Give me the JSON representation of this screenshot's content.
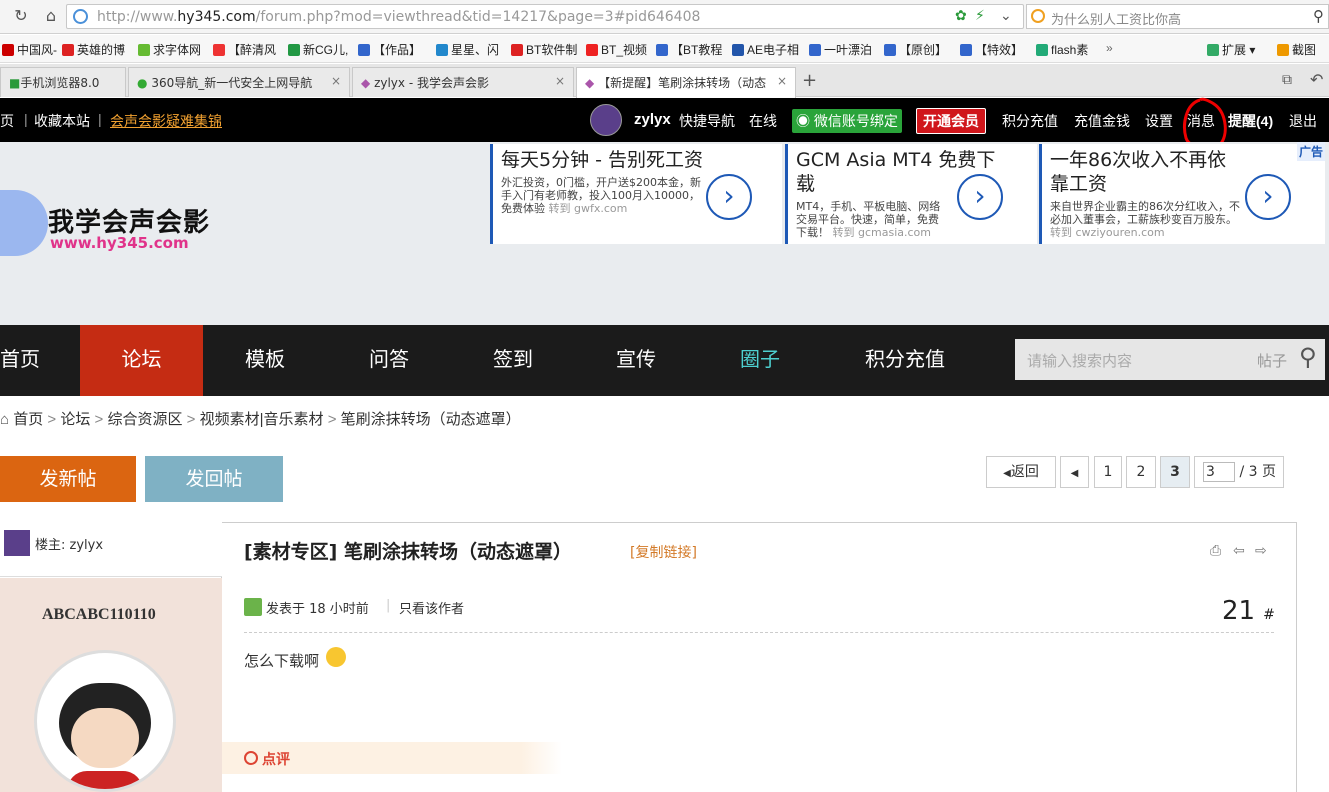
{
  "browser": {
    "url_prefix": "http://www.",
    "url_domain": "hy345.com",
    "url_rest": "/forum.php?mod=viewthread&tid=14217&page=3#pid646408",
    "search_text": "为什么别人工资比你高"
  },
  "bookmarks": [
    "中国风-",
    "英雄的博",
    "求字体网",
    "【醉清风",
    "新CG儿,",
    "【作品】",
    "星星、闪",
    "BT软件制",
    "BT_视频",
    "【BT教程",
    "AE电子相",
    "一叶漂泊",
    "【原创】",
    "【特效】",
    "flash素",
    "扩展",
    "截图"
  ],
  "tabs": [
    {
      "label": "手机浏览器8.0"
    },
    {
      "label": "360导航_新一代安全上网导航"
    },
    {
      "label": "zylyx - 我学会声会影"
    },
    {
      "label": "【新提醒】笔刷涂抹转场（动态"
    }
  ],
  "topbar": {
    "left": [
      "页",
      "收藏本站",
      "会声会影疑难集锦"
    ],
    "username": "zylyx",
    "quick_nav": "快捷导航",
    "online": "在线",
    "wechat": "微信账号绑定",
    "vip": "开通会员",
    "points": "积分充值",
    "recharge": "充值金钱",
    "settings": "设置",
    "messages": "消息",
    "reminders": "提醒(4)",
    "logout": "退出"
  },
  "logo": {
    "name": "我学会声会影",
    "domain": "www.hy345.com"
  },
  "ads": {
    "label": "广告",
    "items": [
      {
        "title": "每天5分钟 - 告别死工资",
        "desc": "外汇投资，0门槛，开户送$200本金，新手入门有老师教，投入100月入10000，免费体验",
        "via": "转到 gwfx.com"
      },
      {
        "title": "GCM Asia MT4 免费下载",
        "desc": "MT4，手机、平板电脑、网络交易平台。快速，简单，免费下载！",
        "via": "转到 gcmasia.com"
      },
      {
        "title": "一年86次收入不再依靠工资",
        "desc": "来自世界企业霸主的86次分红收入，不必加入董事会，工薪族秒变百万股东。",
        "via": "转到 cwziyouren.com"
      }
    ]
  },
  "mainnav": [
    "首页",
    "论坛",
    "模板",
    "问答",
    "签到",
    "宣传",
    "圈子",
    "积分充值"
  ],
  "site_search": {
    "placeholder": "请输入搜索内容",
    "scope": "帖子"
  },
  "breadcrumb": [
    "首页",
    "论坛",
    "综合资源区",
    "视频素材|音乐素材",
    "笔刷涂抹转场（动态遮罩）"
  ],
  "actions": {
    "new_thread": "发新帖",
    "reply": "发回帖"
  },
  "pager": {
    "back": "返回",
    "pages": [
      "1",
      "2",
      "3"
    ],
    "current": "3",
    "total": "/ 3 页"
  },
  "post": {
    "op_label": "楼主: zylyx",
    "title": "[素材专区] 笔刷涂抹转场（动态遮罩）",
    "copy_link": "[复制链接]",
    "author": "ABCABC110110",
    "posted": "发表于 18 小时前",
    "only_author": "只看该作者",
    "floor": "21",
    "floor_mark": "#",
    "content": "怎么下载啊",
    "comment": "点评"
  }
}
